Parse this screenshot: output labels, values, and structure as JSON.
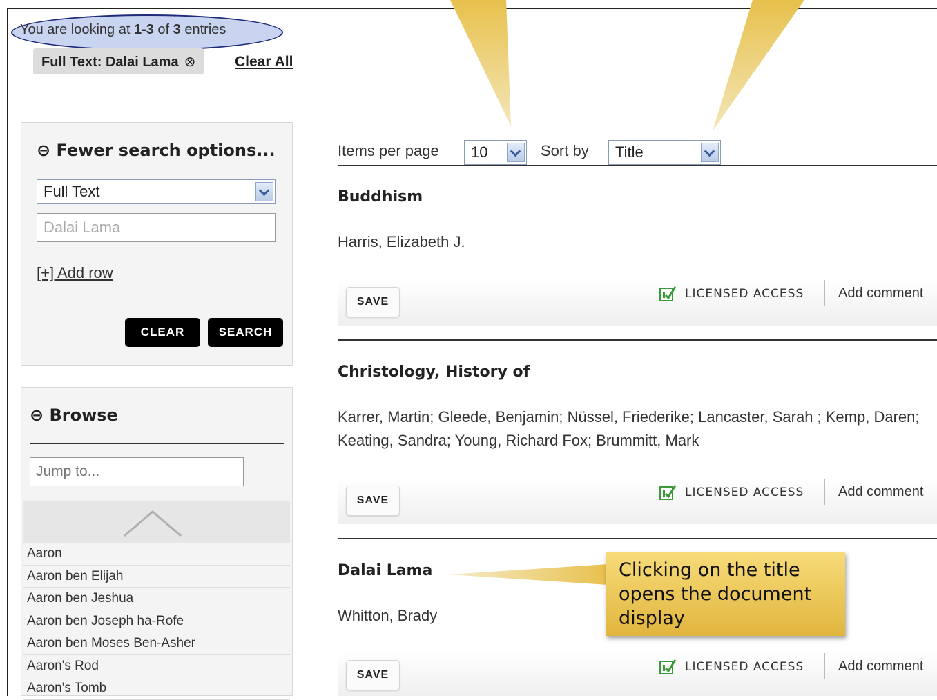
{
  "summary": {
    "prefix": "You are looking at",
    "range": "1-3",
    "of": "of",
    "total": "3",
    "suffix": "entries"
  },
  "active_filter": {
    "label": "Full Text: Dalai Lama",
    "remove_icon": "⊗"
  },
  "clear_all_label": "Clear All",
  "search_panel": {
    "heading": "⊖ Fewer search options...",
    "field_select": "Full Text",
    "query_value": "Dalai Lama",
    "add_row_label": "[+] Add row",
    "clear_label": "CLEAR",
    "search_label": "SEARCH"
  },
  "browse_panel": {
    "heading": "⊖ Browse",
    "jump_placeholder": "Jump to...",
    "items": [
      "Aaron",
      "Aaron ben Elijah",
      "Aaron ben Jeshua",
      "Aaron ben Joseph ha-Rofe",
      "Aaron ben Moses Ben-Asher",
      "Aaron's Rod",
      "Aaron's Tomb"
    ]
  },
  "controls": {
    "items_per_page_label": "Items per page",
    "items_per_page_value": "10",
    "sort_label": "Sort by",
    "sort_value": "Title"
  },
  "results": [
    {
      "title": "Buddhism",
      "authors": "Harris, Elizabeth J.",
      "save_label": "SAVE",
      "access_label": "LICENSED ACCESS",
      "comment_label": "Add comment"
    },
    {
      "title": "Christology, History of",
      "authors": "Karrer, Martin; Gleede, Benjamin; Nüssel, Friederike; Lancaster, Sarah ; Kemp, Daren; Keating, Sandra; Young, Richard Fox; Brummitt, Mark",
      "save_label": "SAVE",
      "access_label": "LICENSED ACCESS",
      "comment_label": "Add comment"
    },
    {
      "title": "Dalai Lama",
      "authors": "Whitton, Brady",
      "save_label": "SAVE",
      "access_label": "LICENSED ACCESS",
      "comment_label": "Add comment"
    }
  ],
  "callout": {
    "text": "Clicking on the title opens the document display"
  },
  "colors": {
    "callout_fill": "#e8c14d",
    "highlight_ellipse": "#c8d4f0",
    "ellipse_border": "#1e2a7a",
    "access_icon": "#3a9a3a"
  },
  "icons": {
    "filter_remove": "circled-x-icon",
    "collapse": "circled-minus-icon",
    "dropdown": "chevron-down-icon",
    "scroll_up": "chevron-up-icon",
    "access": "licensed-access-icon"
  }
}
